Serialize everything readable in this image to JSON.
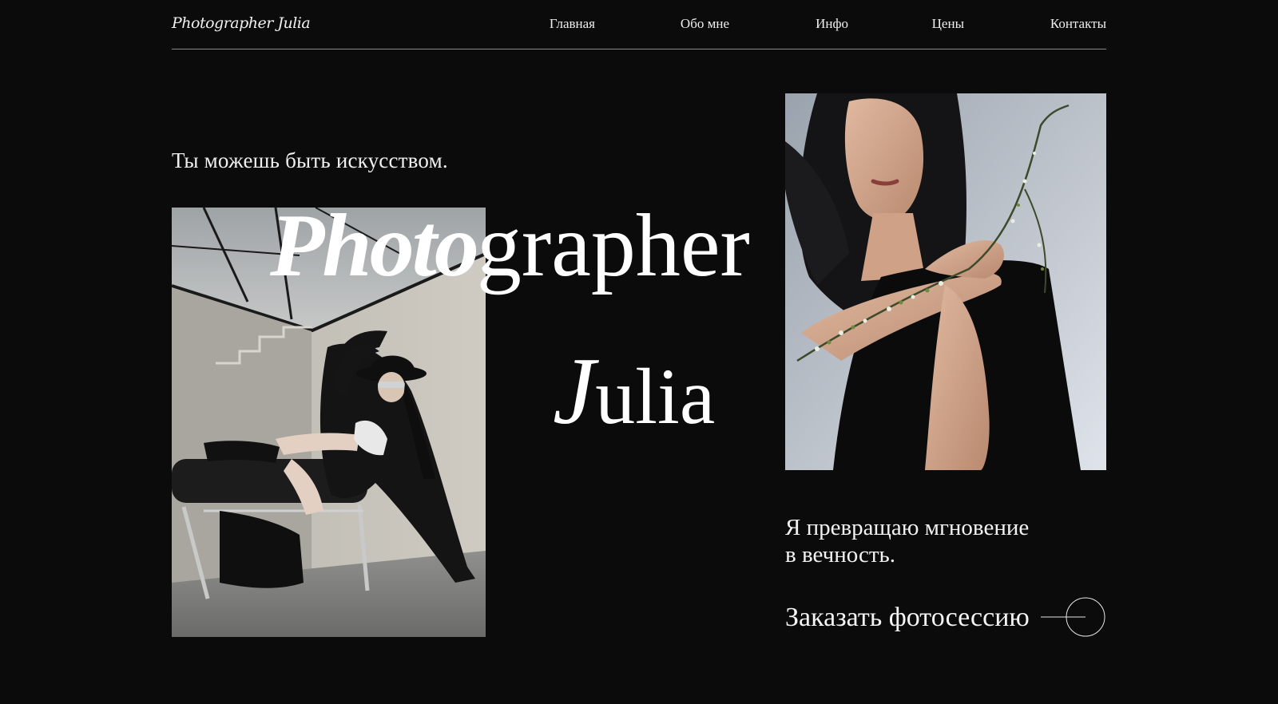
{
  "header": {
    "logo": "Photographer Julia",
    "nav": [
      "Главная",
      "Обо мне",
      "Инфо",
      "Цены",
      "Контакты"
    ]
  },
  "hero": {
    "tagline": "Ты можешь быть искусством.",
    "title_script": "Photo",
    "title_rest": "grapher",
    "name_script": "J",
    "name_rest": "ulia"
  },
  "claim": {
    "line1": "Я превращаю мгновение",
    "line2": "в вечность."
  },
  "cta": {
    "label": "Заказать фотосессию"
  },
  "images": {
    "left": "fashion-portrait-woman-in-hat-on-chair",
    "right": "portrait-woman-with-branch"
  },
  "colors": {
    "background": "#0b0b0b",
    "text": "#f2f2f2",
    "divider": "#8a8a8a"
  }
}
